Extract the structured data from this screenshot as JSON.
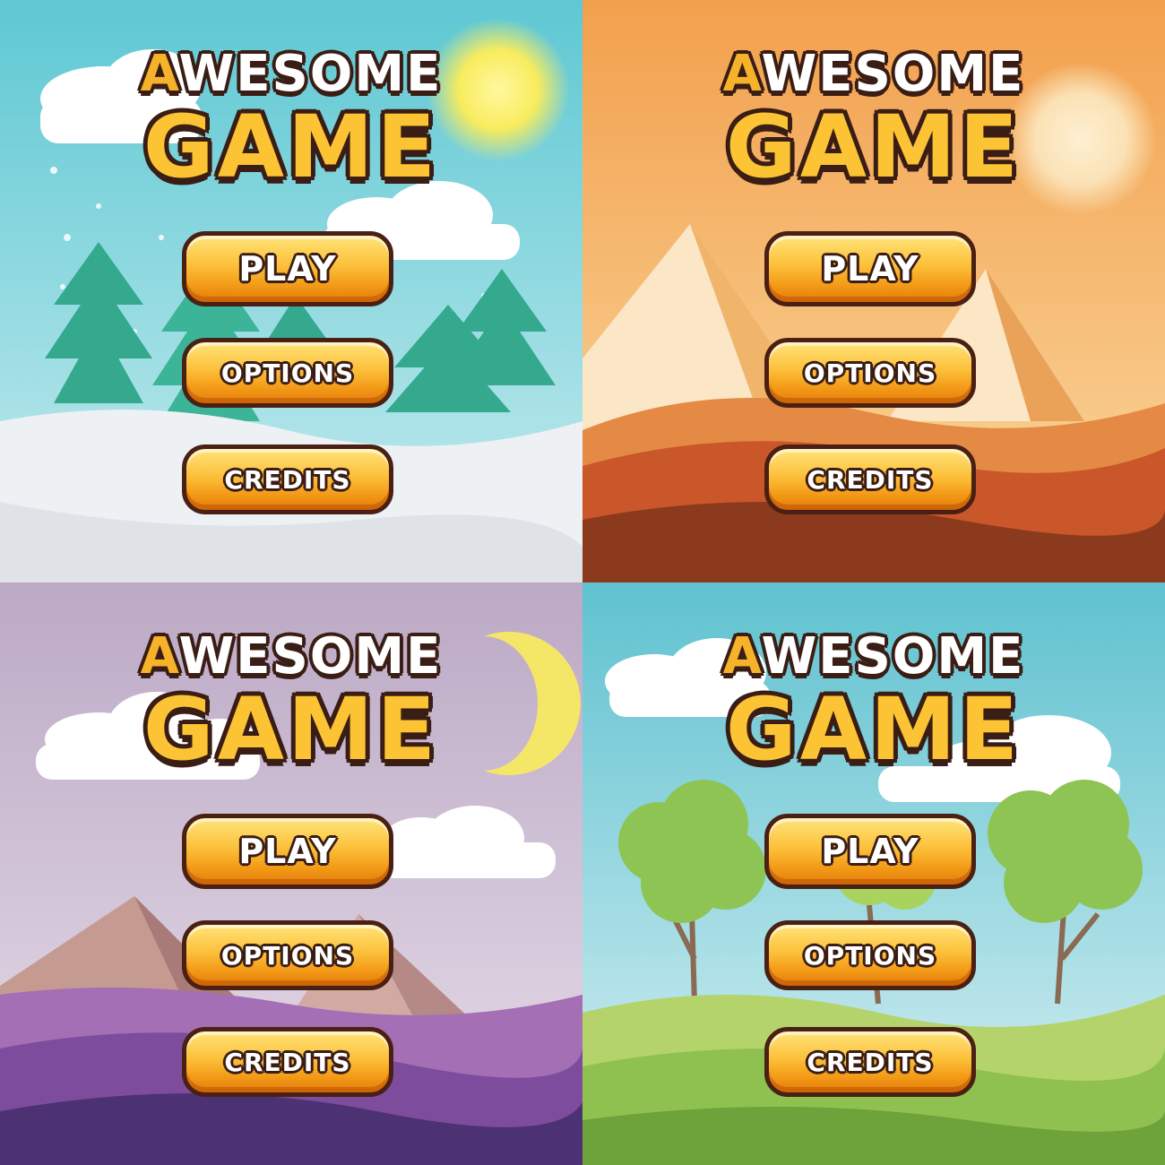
{
  "screens": [
    {
      "theme": "winter",
      "title_line1_first": "A",
      "title_line1_rest": "WESOME",
      "title_line2": "GAME",
      "buttons": {
        "play": "PLAY",
        "options": "OPTIONS",
        "credits": "CREDITS"
      },
      "colors": {
        "sky_top": "#5ec8d3",
        "sky_bottom": "#c7ecef",
        "ground": "#eef1f3",
        "tree": "#34a98e"
      }
    },
    {
      "theme": "desert",
      "title_line1_first": "A",
      "title_line1_rest": "WESOME",
      "title_line2": "GAME",
      "buttons": {
        "play": "PLAY",
        "options": "OPTIONS",
        "credits": "CREDITS"
      },
      "colors": {
        "sky_top": "#f2a04d",
        "sky_bottom": "#fbd9a0",
        "dune": "#c9572a",
        "pyramid": "#f2b368"
      }
    },
    {
      "theme": "night",
      "title_line1_first": "A",
      "title_line1_rest": "WESOME",
      "title_line2": "GAME",
      "buttons": {
        "play": "PLAY",
        "options": "OPTIONS",
        "credits": "CREDITS"
      },
      "colors": {
        "sky_top": "#bca9c5",
        "sky_bottom": "#e6dde9",
        "hills": "#7e4c9d",
        "mountain": "#c59a91"
      }
    },
    {
      "theme": "meadow",
      "title_line1_first": "A",
      "title_line1_rest": "WESOME",
      "title_line2": "GAME",
      "buttons": {
        "play": "PLAY",
        "options": "OPTIONS",
        "credits": "CREDITS"
      },
      "colors": {
        "sky_top": "#5fc2d0",
        "sky_bottom": "#d6eff2",
        "grass": "#8fc150",
        "tree": "#8ec453"
      }
    }
  ]
}
